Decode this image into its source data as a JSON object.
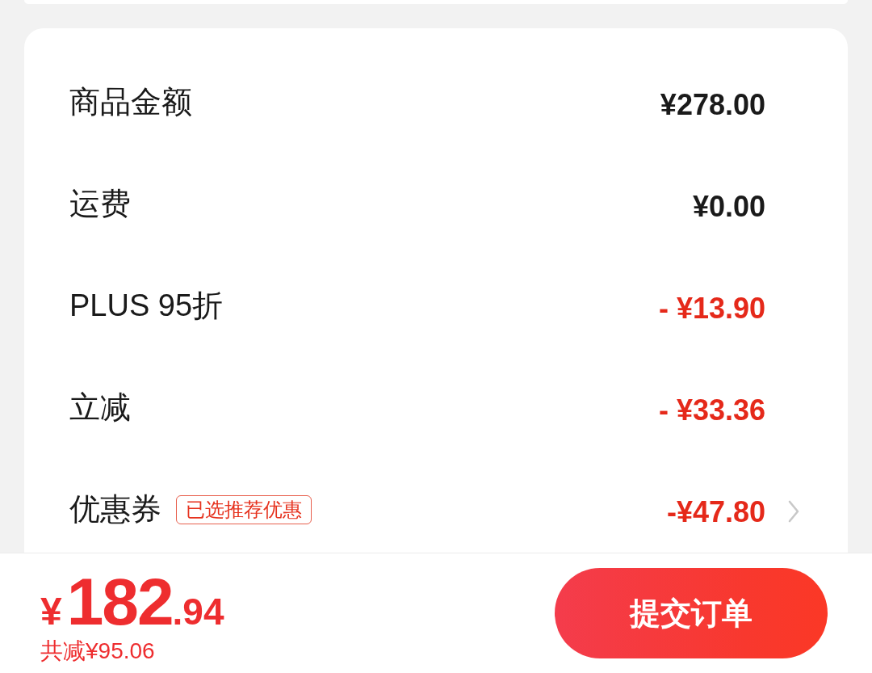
{
  "summary": {
    "rows": [
      {
        "kind": "amount",
        "label": "商品金额",
        "value": "¥278.00"
      },
      {
        "kind": "amount",
        "label": "运费",
        "value": "¥0.00"
      },
      {
        "kind": "discount",
        "label": "PLUS 95折",
        "value": "- ¥13.90"
      },
      {
        "kind": "discount",
        "label": "立减",
        "value": "- ¥33.36"
      },
      {
        "kind": "coupon",
        "label": "优惠券",
        "badge": "已选推荐优惠",
        "value": "-¥47.80"
      }
    ]
  },
  "footer": {
    "total": {
      "currency": "¥",
      "integer": "182",
      "decimal": ".94"
    },
    "savings": "共减¥95.06",
    "submit_button": "提交订单"
  }
}
